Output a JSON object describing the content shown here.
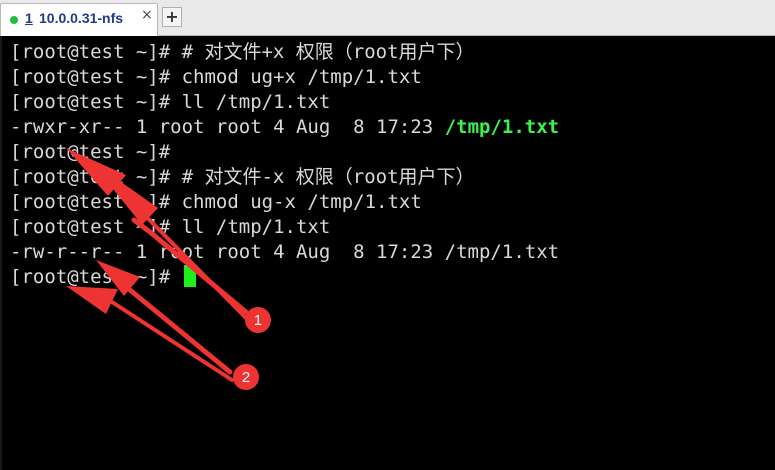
{
  "tabbar": {
    "tab": {
      "index": "1",
      "title": "10.0.0.31-nfs",
      "close_glyph": "×",
      "status_color": "#1fbf3a"
    },
    "new_tab_glyph": "+"
  },
  "terminal": {
    "lines": [
      "[root@test ~]# # 对文件+x 权限（root用户下）",
      "[root@test ~]# chmod ug+x /tmp/1.txt",
      "[root@test ~]# ll /tmp/1.txt",
      {
        "prefix": "-rwxr-xr-- 1 root root 4 Aug  8 17:23 ",
        "highlight": "/tmp/1.txt"
      },
      "[root@test ~]#",
      "[root@test ~]# # 对文件-x 权限（root用户下）",
      "[root@test ~]# chmod ug-x /tmp/1.txt",
      "[root@test ~]# ll /tmp/1.txt",
      "-rw-r--r-- 1 root root 4 Aug  8 17:23 /tmp/1.txt",
      {
        "prompt": "[root@test ~]# "
      }
    ],
    "colors": {
      "text": "#d9d9d9",
      "highlight": "#3df24d",
      "cursor": "#1eef1e"
    }
  },
  "annotations": {
    "badges": [
      {
        "label": "1"
      },
      {
        "label": "2"
      }
    ],
    "arrow_color": "#ee3333"
  }
}
